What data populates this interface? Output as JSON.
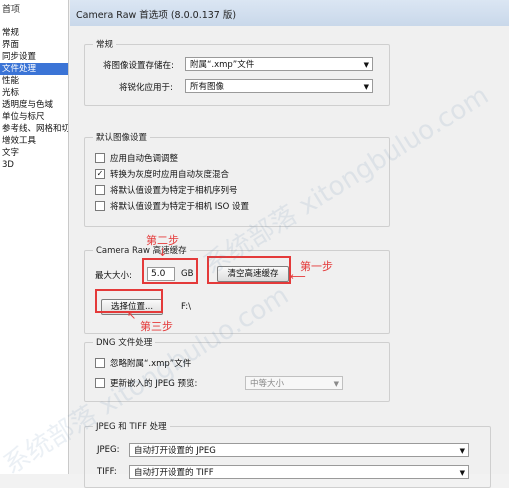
{
  "left_pane": {
    "title": "首项",
    "items": [
      "常规",
      "界面",
      "同步设置",
      "文件处理",
      "性能",
      "光标",
      "透明度与色域",
      "单位与标尺",
      "参考线、网格和切片",
      "增效工具",
      "文字",
      "3D"
    ],
    "active_index": 3
  },
  "dialog": {
    "title": "Camera Raw 首选项 (8.0.0.137 版)"
  },
  "general": {
    "label": "常规",
    "save_settings_label": "将图像设置存储在:",
    "save_settings_value": "附属“.xmp”文件",
    "sharpen_label": "将锐化应用于:",
    "sharpen_value": "所有图像"
  },
  "defaults": {
    "label": "默认图像设置",
    "options": [
      {
        "text": "应用自动色调调整",
        "checked": false
      },
      {
        "text": "转换为灰度时应用自动灰度混合",
        "checked": true
      },
      {
        "text": "将默认值设置为特定于相机序列号",
        "checked": false
      },
      {
        "text": "将默认值设置为特定于相机 ISO 设置",
        "checked": false
      }
    ]
  },
  "cache": {
    "label": "Camera Raw 高速缓存",
    "max_size_label": "最大大小:",
    "max_size_value": "5.0",
    "unit": "GB",
    "purge_button": "清空高速缓存",
    "select_button": "选择位置...",
    "location": "F:\\"
  },
  "dng": {
    "label": "DNG 文件处理",
    "ignore_sidecar": "忽略附属“.xmp”文件",
    "update_jpeg": "更新嵌入的 JPEG 预览:",
    "preview_value": "中等大小"
  },
  "jpeg_tiff": {
    "label": "JPEG 和 TIFF 处理",
    "jpeg_label": "JPEG:",
    "jpeg_value": "自动打开设置的 JPEG",
    "tiff_label": "TIFF:",
    "tiff_value": "自动打开设置的 TIFF"
  },
  "annotations": {
    "step1": "第一步",
    "step2": "第二步",
    "step3": "第三步"
  },
  "watermark": "系统部落 xitongbuluo.com",
  "colors": {
    "annotation": "#e43a3a",
    "selection": "#3b74d6"
  },
  "icons": {
    "dropdown": "chevron-down-icon",
    "check": "check-icon",
    "arrow": "arrow-icon"
  }
}
